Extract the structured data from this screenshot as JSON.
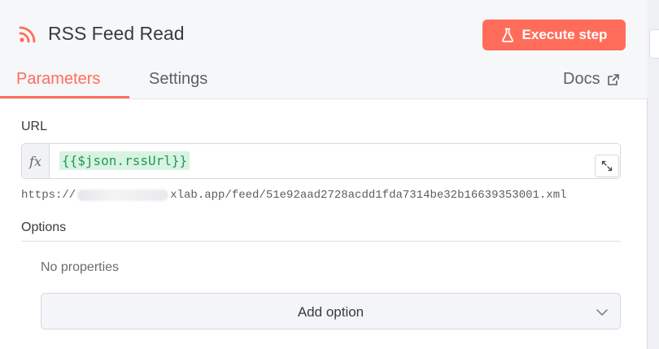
{
  "node": {
    "title": "RSS Feed Read",
    "execute_label": "Execute step",
    "icon": "rss-icon"
  },
  "tabs": [
    {
      "label": "Parameters",
      "active": true
    },
    {
      "label": "Settings",
      "active": false
    }
  ],
  "docs_label": "Docs",
  "url": {
    "label": "URL",
    "fx_label": "fx",
    "expression": "{{$json.rssUrl}}",
    "resolved_prefix": "https://",
    "resolved_suffix": "xlab.app/feed/51e92aad2728acdd1fda7314be32b16639353001.xml"
  },
  "options": {
    "label": "Options",
    "empty_text": "No properties",
    "add_label": "Add option"
  },
  "colors": {
    "accent": "#ff6d5a",
    "expression_text": "#1e9b55",
    "expression_bg": "#d9f3e2"
  }
}
